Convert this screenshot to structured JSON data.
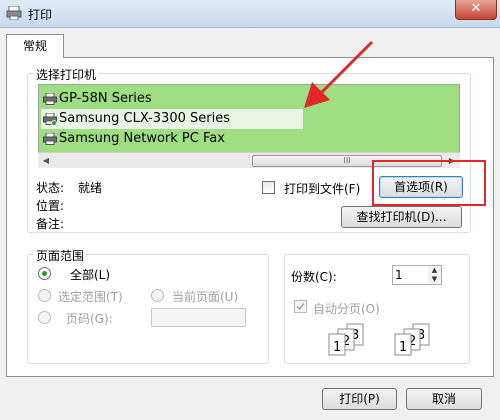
{
  "window": {
    "title": "打印",
    "close_glyph": "✕"
  },
  "tabs": [
    {
      "label": "常规"
    }
  ],
  "select_printer": {
    "caption": "选择打印机",
    "printers": [
      {
        "name": "GP-58N Series"
      },
      {
        "name": "Samsung CLX-3300 Series",
        "selected": true
      },
      {
        "name": "Samsung Network PC Fax"
      }
    ],
    "scroll_thumb_grip": "III"
  },
  "printer_status": {
    "status_label": "状态:",
    "status_value": "就绪",
    "location_label": "位置:",
    "comment_label": "备注:"
  },
  "print_to_file": {
    "label": "打印到文件(F)",
    "checked": false
  },
  "preferences_button": {
    "label": "首选项(R)"
  },
  "find_printer_button": {
    "label": "查找打印机(D)..."
  },
  "page_range": {
    "caption": "页面范围",
    "all": "全部(L)",
    "selection": "选定范围(T)",
    "current_page": "当前页面(U)",
    "pages": "页码(G):",
    "pages_value": ""
  },
  "copies": {
    "label": "份数(C):",
    "value": "1",
    "collate_label": "自动分页(O)",
    "collate_checked": true
  },
  "footer": {
    "print_button": "打印(P)",
    "cancel_button": "取消"
  },
  "colors": {
    "list_background": "#9fdd83",
    "annotation_red": "#e0282b",
    "radio_checked": "#1f9b2d"
  },
  "icons": [
    "printer-icon",
    "close-icon",
    "collate-icon",
    "spinner-up-icon",
    "spinner-down-icon"
  ]
}
